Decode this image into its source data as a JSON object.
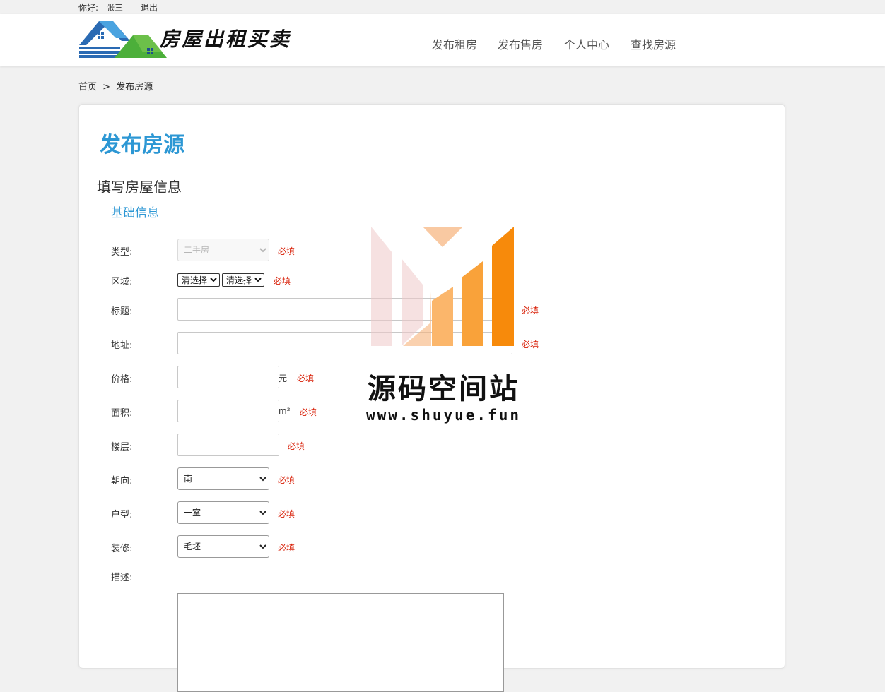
{
  "topbar": {
    "greeting": "你好:",
    "username": "张三",
    "logout": "退出"
  },
  "header": {
    "site_title": "房屋出租买卖",
    "nav": [
      "发布租房",
      "发布售房",
      "个人中心",
      "查找房源"
    ]
  },
  "breadcrumb": {
    "home": "首页",
    "separator": ">",
    "current": "发布房源"
  },
  "card": {
    "title": "发布房源",
    "section": "填写房屋信息",
    "subsection": "基础信息"
  },
  "form": {
    "required_label": "必填",
    "type": {
      "label": "类型:",
      "value": "二手房"
    },
    "region": {
      "label": "区域:",
      "select1": "清选择",
      "select2": "清选择"
    },
    "title": {
      "label": "标题:"
    },
    "address": {
      "label": "地址:"
    },
    "price": {
      "label": "价格:",
      "unit": "元"
    },
    "area": {
      "label": "面积:",
      "unit": "m²"
    },
    "floor": {
      "label": "楼层:"
    },
    "orientation": {
      "label": "朝向:",
      "value": "南"
    },
    "layout": {
      "label": "户型:",
      "value": "一室"
    },
    "decoration": {
      "label": "装修:",
      "value": "毛坯"
    },
    "description": {
      "label": "描述:"
    }
  },
  "watermark": {
    "text": "源码空间站",
    "url": "www.shuyue.fun"
  },
  "colors": {
    "accent": "#2c97d4",
    "required": "#d81e06",
    "watermark_orange": "#f78a0b"
  }
}
